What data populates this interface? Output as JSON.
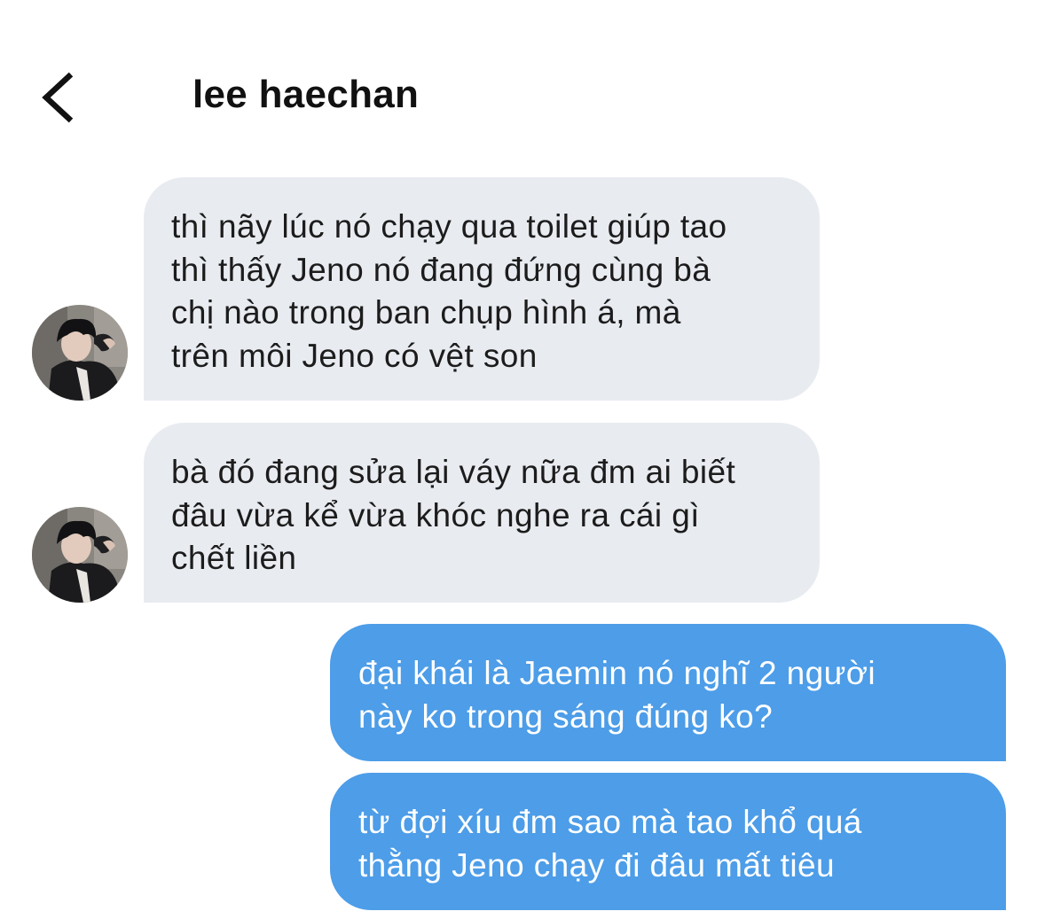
{
  "header": {
    "title": "lee haechan",
    "back_icon": "chevron-left-icon"
  },
  "colors": {
    "incoming_bubble": "#e8ebf0",
    "outgoing_bubble": "#4d9de8",
    "incoming_text": "#1c1c1c",
    "outgoing_text": "#ffffff"
  },
  "messages": [
    {
      "sender": "lee haechan",
      "direction": "incoming",
      "text": "thì nãy lúc nó chạy qua toilet giúp tao\nthì thấy Jeno nó đang đứng cùng bà\nchị nào trong ban chụp hình á, mà\ntrên môi Jeno có vệt son"
    },
    {
      "sender": "lee haechan",
      "direction": "incoming",
      "text": "bà đó đang sửa lại váy nữa đm ai biết\nđâu vừa kể vừa khóc nghe ra cái gì\nchết liền"
    },
    {
      "sender": "me",
      "direction": "outgoing",
      "text": "đại khái là Jaemin nó nghĩ 2 người\nnày ko trong sáng đúng ko?"
    },
    {
      "sender": "me",
      "direction": "outgoing",
      "text": "từ đợi xíu đm sao mà tao khổ quá\nthằng Jeno chạy đi đâu mất tiêu"
    }
  ]
}
